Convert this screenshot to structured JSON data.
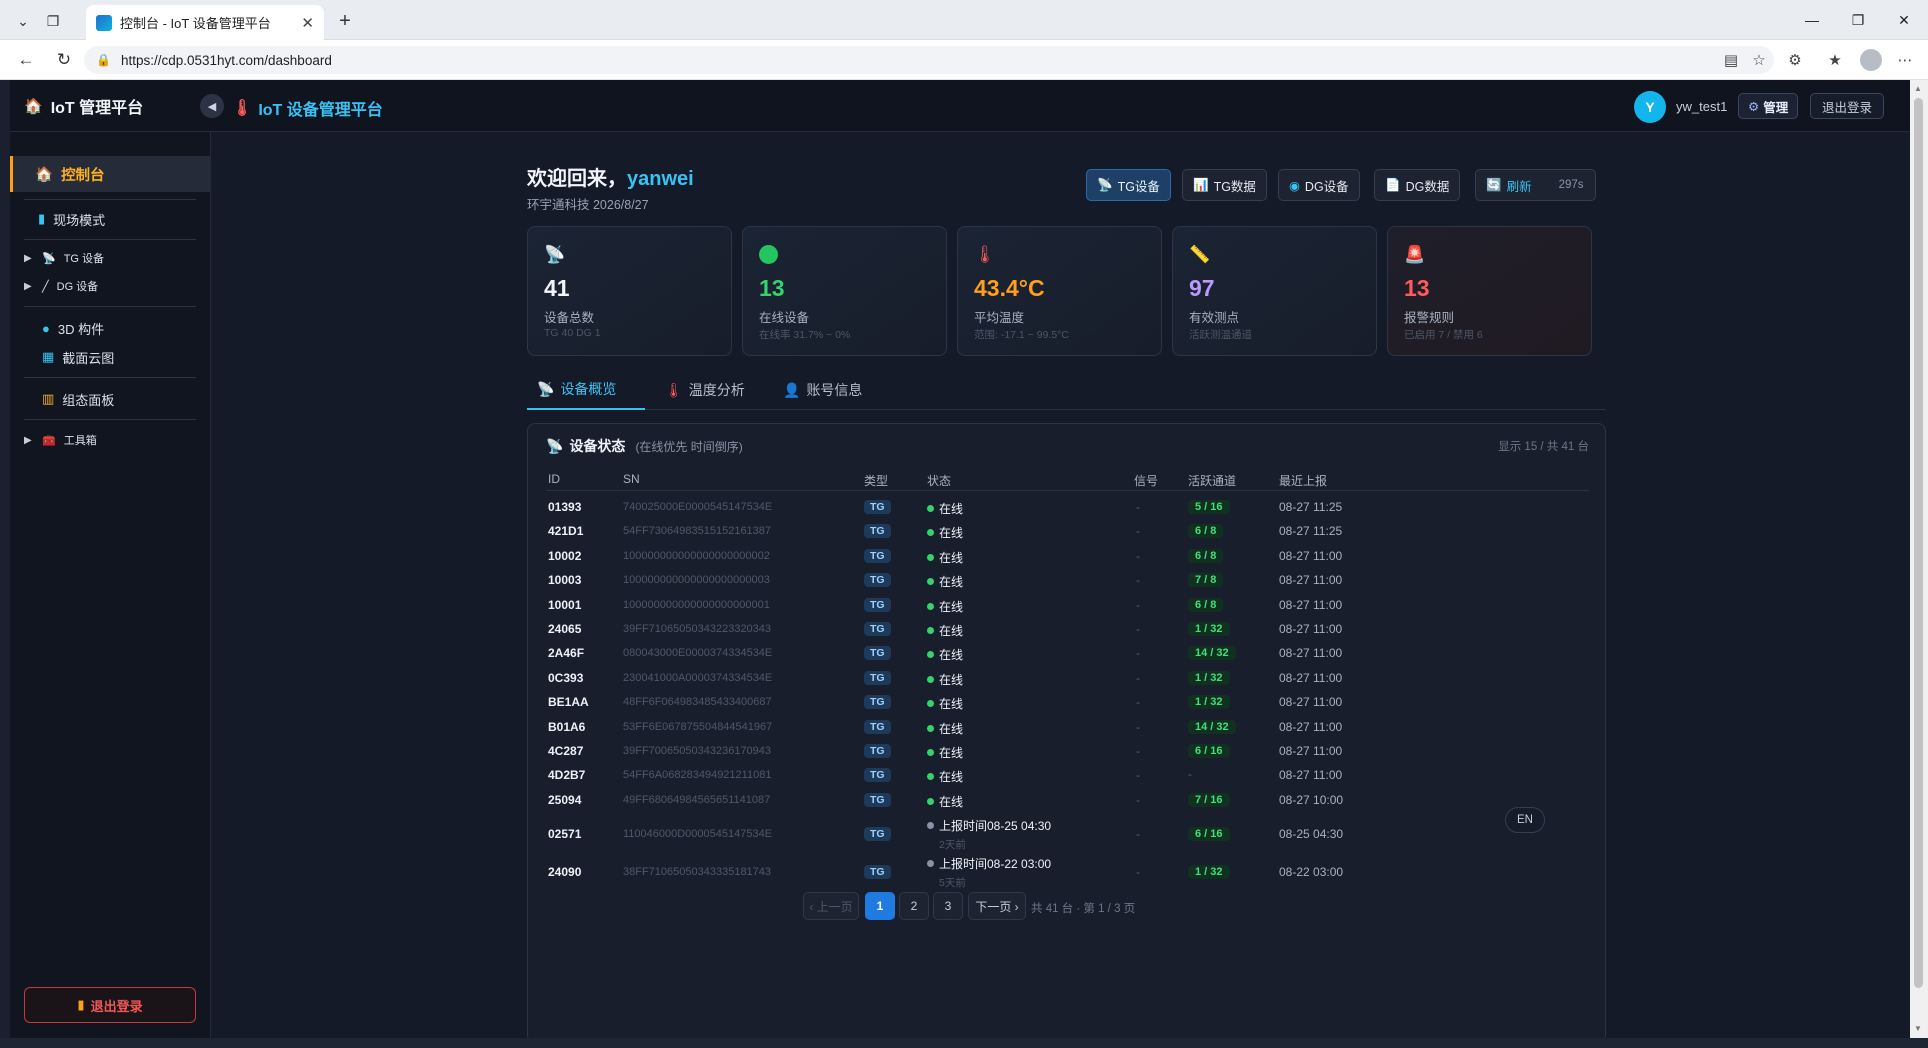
{
  "browser": {
    "tab_title": "控制台 - IoT 设备管理平台",
    "url": "https://cdp.0531hyt.com/dashboard"
  },
  "header": {
    "brand": "IoT 管理平台",
    "platform_title": "IoT 设备管理平台",
    "avatar_letter": "Y",
    "username": "yw_test1",
    "admin_label": "管理",
    "logout_label": "退出登录"
  },
  "sidebar": {
    "dashboard": "控制台",
    "field_mode": "现场模式",
    "tg_devices": "TG 设备",
    "dg_devices": "DG 设备",
    "components_3d": "3D 构件",
    "section_cloud": "截面云图",
    "config_panel": "组态面板",
    "toolbox": "工具箱",
    "logout": "退出登录"
  },
  "welcome": {
    "prefix": "欢迎回来，",
    "user": "yanwei",
    "subline": "环宇通科技 2026/8/27"
  },
  "quick_actions": {
    "tg_devices": "TG设备",
    "tg_data": "TG数据",
    "dg_devices": "DG设备",
    "dg_data": "DG数据",
    "refresh": "刷新",
    "countdown": "297s"
  },
  "stats": [
    {
      "value": "41",
      "label": "设备总数",
      "sub": "TG 40 DG 1",
      "color": "#f2f5fa"
    },
    {
      "value": "13",
      "label": "在线设备",
      "sub": "在线率 31.7% ~ 0%",
      "color": "#36d36b"
    },
    {
      "value": "43.4°C",
      "label": "平均温度",
      "sub": "范围: -17.1 ~ 99.5°C",
      "color": "#ff9f1a"
    },
    {
      "value": "97",
      "label": "有效测点",
      "sub": "活跃测温通道",
      "color": "#b99aff"
    },
    {
      "value": "13",
      "label": "报警规则",
      "sub": "已启用 7 / 禁用 6",
      "color": "#ff5b5b"
    }
  ],
  "tabs": {
    "overview": "设备概览",
    "temperature": "温度分析",
    "account": "账号信息"
  },
  "device_panel": {
    "title": "设备状态",
    "hint": "(在线优先 时间倒序)",
    "count": "显示 15 / 共 41 台",
    "columns": [
      "ID",
      "SN",
      "类型",
      "状态",
      "信号",
      "活跃通道",
      "最近上报"
    ],
    "rows": [
      {
        "id": "01393",
        "sn": "740025000E0000545147534E",
        "type": "TG",
        "status": "在线",
        "signal": "-",
        "channels": "5 / 16",
        "last": "08-27 11:25"
      },
      {
        "id": "421D1",
        "sn": "54FF7306498351515216138​7",
        "type": "TG",
        "status": "在线",
        "signal": "-",
        "channels": "6 / 8",
        "last": "08-27 11:25"
      },
      {
        "id": "10002",
        "sn": "100000000000000000000002",
        "type": "TG",
        "status": "在线",
        "signal": "-",
        "channels": "6 / 8",
        "last": "08-27 11:00"
      },
      {
        "id": "10003",
        "sn": "100000000000000000000003",
        "type": "TG",
        "status": "在线",
        "signal": "-",
        "channels": "7 / 8",
        "last": "08-27 11:00"
      },
      {
        "id": "10001",
        "sn": "100000000000000000000001",
        "type": "TG",
        "status": "在线",
        "signal": "-",
        "channels": "6 / 8",
        "last": "08-27 11:00"
      },
      {
        "id": "24065",
        "sn": "39FF71065050343223320343",
        "type": "TG",
        "status": "在线",
        "signal": "-",
        "channels": "1 / 32",
        "last": "08-27 11:00"
      },
      {
        "id": "2A46F",
        "sn": "080043000E0000374334534E",
        "type": "TG",
        "status": "在线",
        "signal": "-",
        "channels": "14 / 32",
        "last": "08-27 11:00"
      },
      {
        "id": "0C393",
        "sn": "230041000A0000374334534E",
        "type": "TG",
        "status": "在线",
        "signal": "-",
        "channels": "1 / 32",
        "last": "08-27 11:00"
      },
      {
        "id": "BE1AA",
        "sn": "48FF6F064983485433400687",
        "type": "TG",
        "status": "在线",
        "signal": "-",
        "channels": "1 / 32",
        "last": "08-27 11:00"
      },
      {
        "id": "B01A6",
        "sn": "53FF6E067875504844541967",
        "type": "TG",
        "status": "在线",
        "signal": "-",
        "channels": "14 / 32",
        "last": "08-27 11:00"
      },
      {
        "id": "4C287",
        "sn": "39FF70065050343236170943",
        "type": "TG",
        "status": "在线",
        "signal": "-",
        "channels": "6 / 16",
        "last": "08-27 11:00"
      },
      {
        "id": "4D2B7",
        "sn": "54FF6A068283494921211081",
        "type": "TG",
        "status": "在线",
        "signal": "-",
        "channels": "-",
        "last": "08-27 11:00"
      },
      {
        "id": "25094",
        "sn": "49FF68064984565651141087",
        "type": "TG",
        "status": "在线",
        "signal": "-",
        "channels": "7 / 16",
        "last": "08-27 10:00"
      }
    ],
    "offline_rows": [
      {
        "id": "02571",
        "sn": "110046000D0000545147534E",
        "type": "TG",
        "status": "上报时间08-25 04:30",
        "ago": "2天前",
        "signal": "-",
        "channels": "6 / 16",
        "last": "08-25 04:30"
      },
      {
        "id": "24090",
        "sn": "38FF71065050343335181743",
        "type": "TG",
        "status": "上报时间08-22 03:00",
        "ago": "5天前",
        "signal": "-",
        "channels": "1 / 32",
        "last": "08-22 03:00"
      }
    ]
  },
  "pagination": {
    "prev": "‹ 上一页",
    "pages": [
      "1",
      "2",
      "3"
    ],
    "next": "下一页 ›",
    "info": "共 41 台 · 第 1 / 3 页"
  },
  "lang_toggle": "EN"
}
